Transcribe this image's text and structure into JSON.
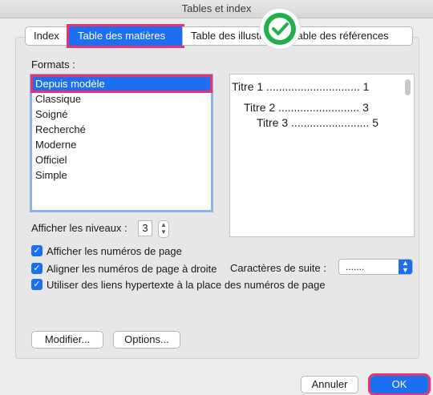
{
  "window": {
    "title": "Tables et index"
  },
  "tabs": [
    {
      "label": "Index"
    },
    {
      "label": "Table des matières"
    },
    {
      "label": "Table des illustr"
    },
    {
      "label": "Table des références"
    }
  ],
  "formats": {
    "label": "Formats :",
    "items": [
      "Depuis modèle",
      "Classique",
      "Soigné",
      "Recherché",
      "Moderne",
      "Officiel",
      "Simple"
    ],
    "selected": "Depuis modèle"
  },
  "preview": {
    "lines": [
      {
        "text": "Titre 1",
        "dots": "..............................",
        "page": "1"
      },
      {
        "text": "Titre 2",
        "dots": "..........................",
        "page": "3"
      },
      {
        "text": "Titre 3",
        "dots": ".........................",
        "page": "5"
      }
    ]
  },
  "levels": {
    "label": "Afficher les niveaux :",
    "value": "3"
  },
  "options": {
    "show_page_numbers": {
      "label": "Afficher les numéros de page",
      "checked": true
    },
    "align_page_numbers": {
      "label": "Aligner les numéros de page à droite",
      "checked": true
    },
    "use_hyperlinks": {
      "label": "Utiliser des liens hypertexte à la place des numéros de page",
      "checked": true
    }
  },
  "leader": {
    "label": "Caractères de suite :",
    "value": "......."
  },
  "buttons": {
    "modify": "Modifier...",
    "options": "Options...",
    "cancel": "Annuler",
    "ok": "OK"
  },
  "colors": {
    "accent": "#1d6ff2",
    "highlight": "#e8336f",
    "check_badge": "#22b04a"
  },
  "icons": {
    "badge": "check-circle-icon",
    "stepper": "stepper-icon",
    "select_arrow": "chevron-updown-icon"
  }
}
